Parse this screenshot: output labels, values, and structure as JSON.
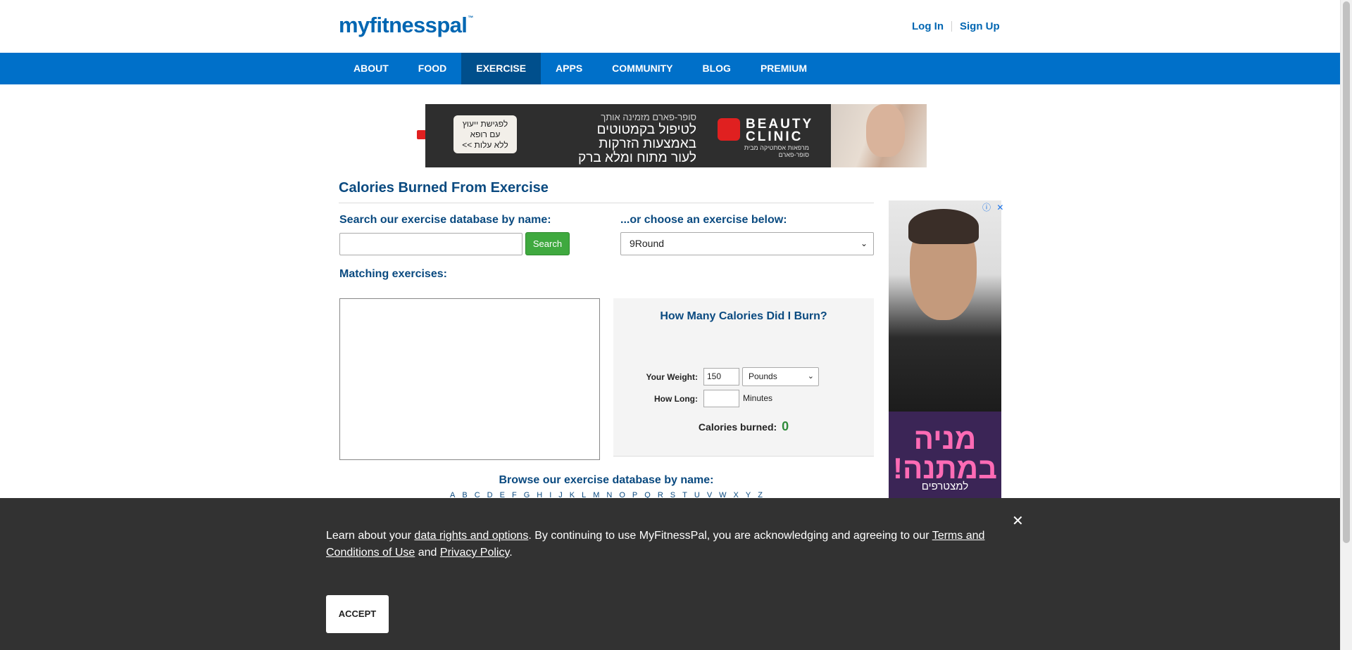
{
  "header": {
    "logo": "myfitnesspal",
    "logo_tm": "™",
    "login_label": "Log In",
    "signup_label": "Sign Up"
  },
  "nav": {
    "items": [
      {
        "label": "ABOUT"
      },
      {
        "label": "FOOD"
      },
      {
        "label": "EXERCISE",
        "active": true
      },
      {
        "label": "APPS"
      },
      {
        "label": "COMMUNITY"
      },
      {
        "label": "BLOG"
      },
      {
        "label": "PREMIUM"
      }
    ]
  },
  "banner_ad": {
    "cta_lines": [
      "לפגישת ייעוץ",
      "עם רופא",
      "ללא עלות >>"
    ],
    "small_line": "סופר-פארם מזמינה אותך",
    "big_lines": [
      "לטיפול בקמטוטים",
      "באמצעות הזרקות",
      "לעור מתוח ומלא ברק"
    ],
    "brand_lines": [
      "BEAUTY",
      "CLINIC"
    ],
    "brand_sub": "מרפאות אסתטיקה מבית סופר-פארם"
  },
  "main": {
    "title": "Calories Burned From Exercise",
    "search_label": "Search our exercise database by name:",
    "search_value": "",
    "search_button": "Search",
    "choose_label": "...or choose an exercise below:",
    "selected_exercise": "9Round",
    "matching_label": "Matching exercises:",
    "browse_label": "Browse our exercise database by name:",
    "letters": [
      "A",
      "B",
      "C",
      "D",
      "E",
      "F",
      "G",
      "H",
      "I",
      "J",
      "K",
      "L",
      "M",
      "N",
      "O",
      "P",
      "Q",
      "R",
      "S",
      "T",
      "U",
      "V",
      "W",
      "X",
      "Y",
      "Z"
    ]
  },
  "calculator": {
    "title": "How Many Calories Did I Burn?",
    "weight_label": "Your Weight:",
    "weight_value": "150",
    "weight_unit": "Pounds",
    "duration_label": "How Long:",
    "duration_value": "",
    "duration_unit": "Minutes",
    "burned_label": "Calories burned:",
    "burned_value": "0"
  },
  "side_ad": {
    "headline_lines": [
      "מניה",
      "במתנה!"
    ],
    "sub": "למצטרפים",
    "info_icon": "ⓘ",
    "close_icon": "✕"
  },
  "cookie": {
    "text_1": "Learn about your ",
    "link_rights": "data rights and options",
    "text_2": ". By continuing to use MyFitnessPal, you are acknowledging and agreeing to our ",
    "link_terms": "Terms and Conditions of Use",
    "text_3": " and ",
    "link_privacy": "Privacy Policy",
    "text_4": ".",
    "accept_label": "ACCEPT",
    "close_icon": "✕"
  },
  "colors": {
    "brand_blue": "#0066b2",
    "nav_blue": "#0070c9",
    "nav_active": "#004f8c",
    "heading_blue": "#0a4a80",
    "search_green": "#3fa93f",
    "burned_green": "#2e8b3a",
    "overlay": "#323232"
  }
}
